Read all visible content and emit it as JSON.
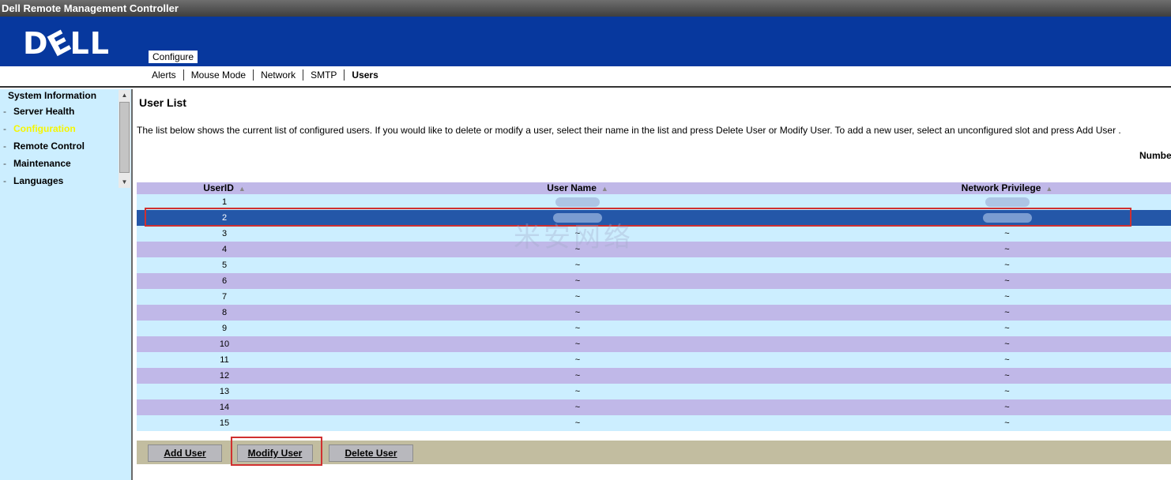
{
  "window": {
    "title": "Dell Remote Management Controller"
  },
  "brand": {
    "logo_text": "DELL"
  },
  "top_tabs": {
    "active": "Configure"
  },
  "sub_nav": [
    {
      "label": "Alerts"
    },
    {
      "label": "Mouse Mode"
    },
    {
      "label": "Network"
    },
    {
      "label": "SMTP"
    },
    {
      "label": "Users"
    }
  ],
  "sidebar": {
    "items": [
      {
        "label": "System Information"
      },
      {
        "label": "Server Health"
      },
      {
        "label": "Configuration"
      },
      {
        "label": "Remote Control"
      },
      {
        "label": "Maintenance"
      },
      {
        "label": "Languages"
      }
    ]
  },
  "page": {
    "title": "User List",
    "description": "The list below shows the current list of configured users. If you would like to delete or modify a user, select their name in the list and press Delete User or Modify User. To add a new user, select an unconfigured slot and press Add User .",
    "number_label": "Numbe"
  },
  "table": {
    "headers": [
      "UserID",
      "User Name",
      "Network Privilege"
    ],
    "sort_glyph": "▲",
    "rows": [
      {
        "id": "1",
        "name": "",
        "priv": ""
      },
      {
        "id": "2",
        "name": "",
        "priv": ""
      },
      {
        "id": "3",
        "name": "~",
        "priv": "~"
      },
      {
        "id": "4",
        "name": "~",
        "priv": "~"
      },
      {
        "id": "5",
        "name": "~",
        "priv": "~"
      },
      {
        "id": "6",
        "name": "~",
        "priv": "~"
      },
      {
        "id": "7",
        "name": "~",
        "priv": "~"
      },
      {
        "id": "8",
        "name": "~",
        "priv": "~"
      },
      {
        "id": "9",
        "name": "~",
        "priv": "~"
      },
      {
        "id": "10",
        "name": "~",
        "priv": "~"
      },
      {
        "id": "11",
        "name": "~",
        "priv": "~"
      },
      {
        "id": "12",
        "name": "~",
        "priv": "~"
      },
      {
        "id": "13",
        "name": "~",
        "priv": "~"
      },
      {
        "id": "14",
        "name": "~",
        "priv": "~"
      },
      {
        "id": "15",
        "name": "~",
        "priv": "~"
      }
    ]
  },
  "buttons": {
    "add": "Add User",
    "modify": "Modify User",
    "delete": "Delete User"
  },
  "watermark": {
    "text": "米安网络"
  },
  "colors": {
    "banner_blue": "#07389e",
    "row_light": "#cceeff",
    "row_lavender": "#c0b8e8",
    "row_selected": "#2457a8",
    "highlight_red": "#d03030",
    "active_nav_yellow": "#f5f500"
  }
}
